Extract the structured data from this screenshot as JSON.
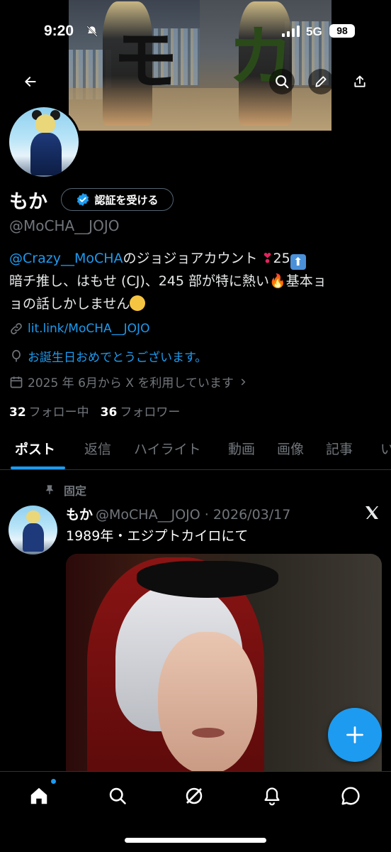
{
  "status_bar": {
    "time": "9:20",
    "network": "5G",
    "battery": "98"
  },
  "banner": {
    "kana_left": "モ",
    "kana_right": "カ"
  },
  "profile": {
    "name": "もか",
    "verify_label": "認証を受ける",
    "handle": "@MoCHA__JOJO",
    "bio": {
      "mention": "@Crazy__MoCHA",
      "line1_rest": "のジョジョアカウント",
      "line1_num": "25",
      "line2": "暗チ推し、はもせ (CJ)、245 部が特に熱い",
      "line2_rest": "基本ョ",
      "line3": "ョの話しかしません"
    },
    "link": "lit.link/MoCHA__JOJO",
    "birthday": "お誕生日おめでとうございます。",
    "joined": "2025 年 6月から X を利用しています"
  },
  "follow": {
    "following_count": "32",
    "following_label": "フォロー中",
    "followers_count": "36",
    "followers_label": "フォロワー"
  },
  "tabs": [
    "ポスト",
    "返信",
    "ハイライト",
    "動画",
    "画像",
    "記事",
    "い"
  ],
  "post": {
    "pinned_label": "固定",
    "name": "もか",
    "handle_date": "@MoCHA__JOJO · 2026/03/17",
    "text": "1989年・エジプトカイロにて"
  },
  "colors": {
    "accent": "#1d9bf0",
    "background": "#000000",
    "muted": "#71767b"
  },
  "icons": [
    "back-arrow-icon",
    "search-icon",
    "edit-icon",
    "share-icon",
    "verified-badge-icon",
    "link-icon",
    "balloon-icon",
    "calendar-icon",
    "chevron-right-icon",
    "pin-icon",
    "x-logo-icon",
    "plus-icon",
    "home-icon",
    "explore-icon",
    "grok-icon",
    "notifications-icon",
    "messages-icon"
  ]
}
